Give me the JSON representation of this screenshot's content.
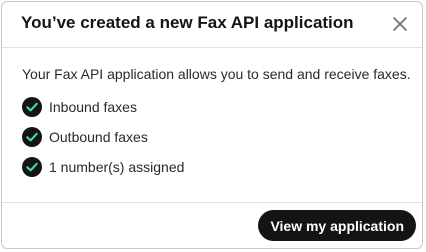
{
  "dialog": {
    "title": "You’ve created a new Fax API application",
    "close_icon": "close-icon",
    "description": "Your Fax API application allows you to send and receive faxes.",
    "features": [
      {
        "label": "Inbound faxes",
        "icon": "check-circle-icon"
      },
      {
        "label": "Outbound faxes",
        "icon": "check-circle-icon"
      },
      {
        "label": "1 number(s) assigned",
        "icon": "check-circle-icon"
      }
    ],
    "primary_button_label": "View my application"
  },
  "colors": {
    "check_fill": "#141414",
    "check_mark": "#2fe3a0",
    "button_bg": "#141414",
    "button_text": "#ffffff"
  }
}
